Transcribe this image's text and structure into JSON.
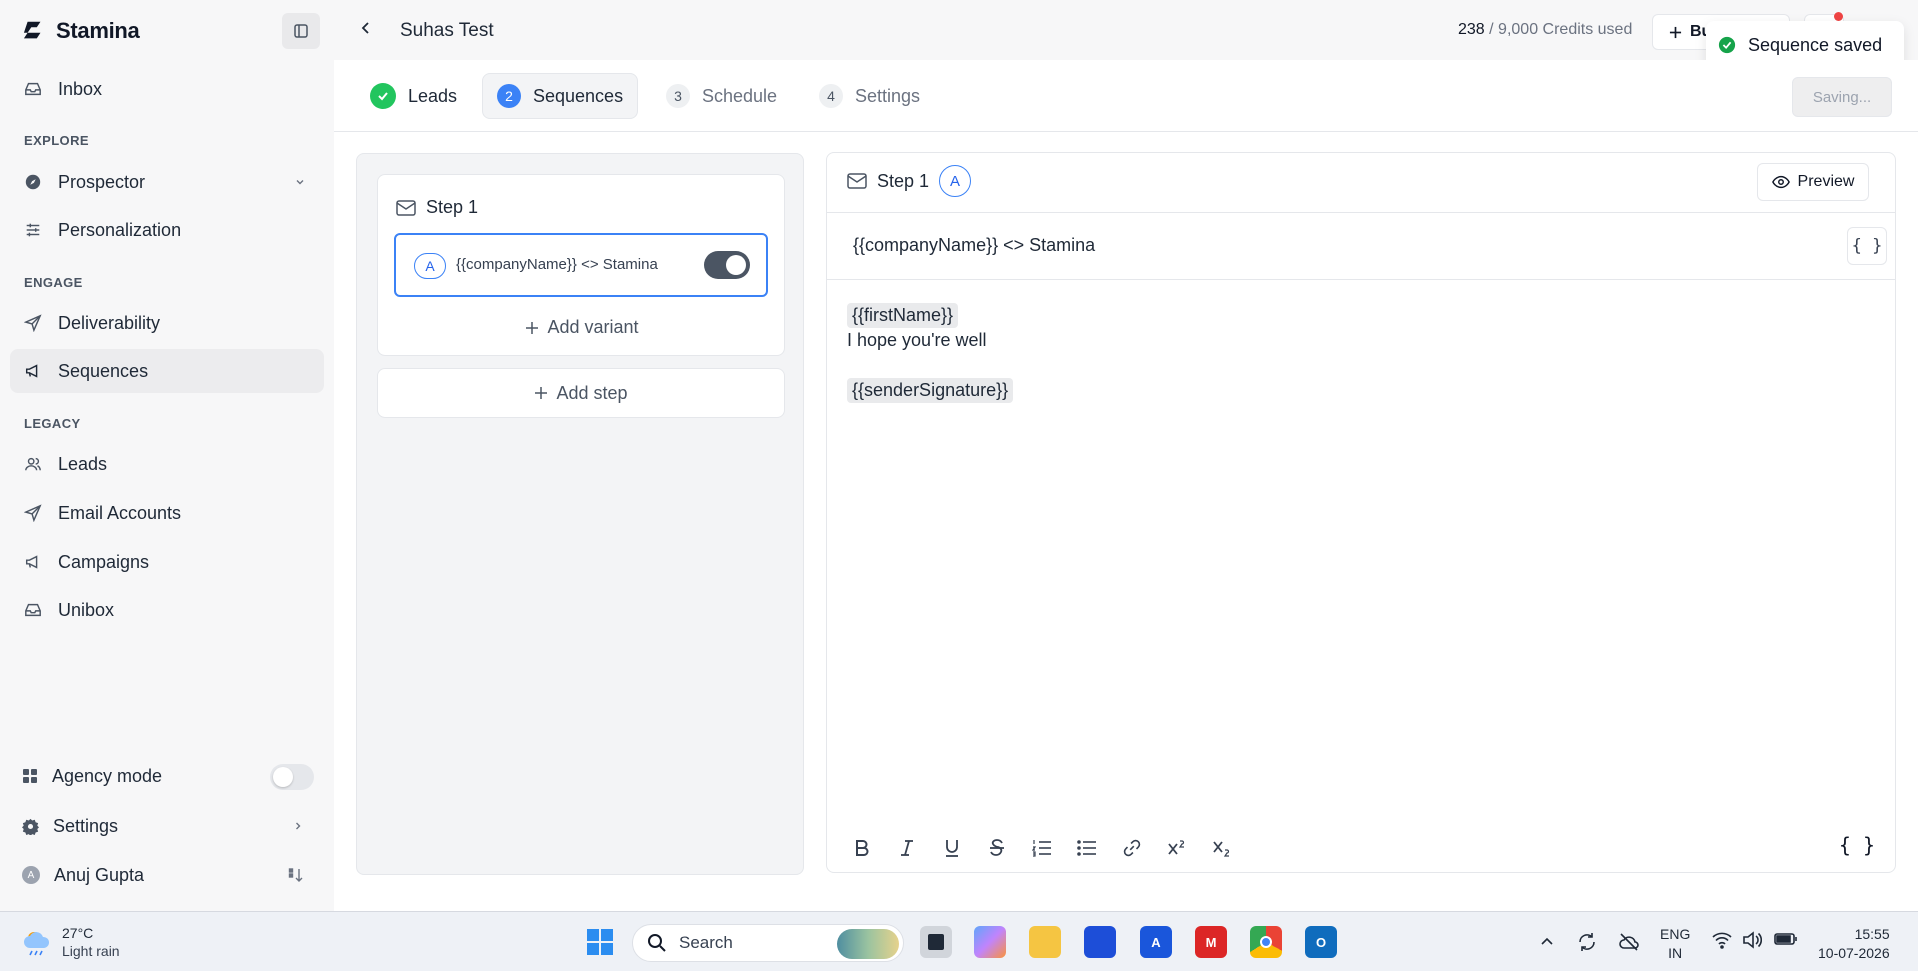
{
  "app": {
    "name": "Stamina"
  },
  "sidebar": {
    "inbox": "Inbox",
    "sections": {
      "explore": "EXPLORE",
      "engage": "ENGAGE",
      "legacy": "LEGACY"
    },
    "items": {
      "prospector": "Prospector",
      "personalization": "Personalization",
      "deliverability": "Deliverability",
      "sequences": "Sequences",
      "leads": "Leads",
      "email_accounts": "Email Accounts",
      "campaigns": "Campaigns",
      "unibox": "Unibox"
    },
    "agency_mode": "Agency mode",
    "settings": "Settings",
    "user_name": "Anuj Gupta",
    "user_initial": "A"
  },
  "header": {
    "title": "Suhas Test",
    "credits_used": "238",
    "credits_total": "/ 9,000 Credits used",
    "buy_label": "Bu"
  },
  "toast": {
    "message": "Sequence saved"
  },
  "tabs": [
    {
      "num": "",
      "label": "Leads"
    },
    {
      "num": "2",
      "label": "Sequences"
    },
    {
      "num": "3",
      "label": "Schedule"
    },
    {
      "num": "4",
      "label": "Settings"
    }
  ],
  "saving_label": "Saving...",
  "steps": {
    "step_title": "Step 1",
    "variant_badge": "A",
    "variant_subject": "{{companyName}} <> Stamina",
    "add_variant": "Add variant",
    "add_step": "Add step"
  },
  "editor": {
    "step_title": "Step 1",
    "variant_badge": "A",
    "preview_label": "Preview",
    "subject": "{{companyName}} <> Stamina",
    "brace_label": "{ }",
    "body": {
      "line1": "{{firstName}}",
      "line2": "I hope you're well",
      "line3": "{{senderSignature}}"
    },
    "toolbar": [
      "B",
      "I",
      "U",
      "S",
      "ordered-list",
      "bullet-list",
      "link",
      "x²",
      "x₂"
    ],
    "toolbar_brace": "{ }"
  },
  "taskbar": {
    "temperature": "27°C",
    "weather": "Light rain",
    "search": "Search",
    "lang1": "ENG",
    "lang2": "IN",
    "time": "15:55",
    "date": "10-07-2026"
  },
  "colors": {
    "accent": "#3b82f6",
    "success": "#22c55e",
    "notification": "#ef4444"
  }
}
